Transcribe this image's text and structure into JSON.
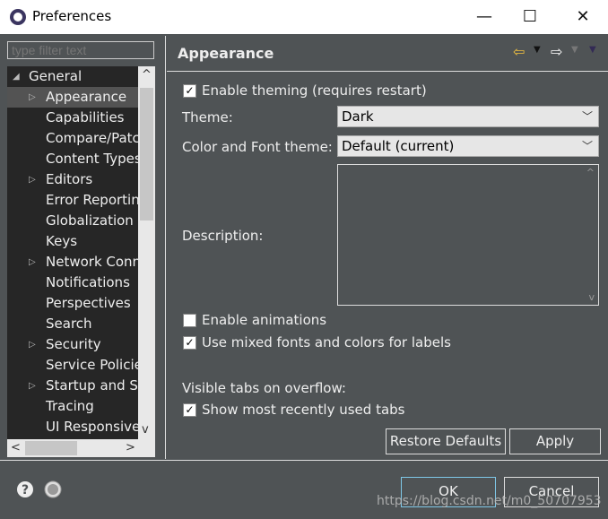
{
  "window": {
    "title": "Preferences",
    "minimize": "—",
    "maximize": "☐",
    "close": "✕"
  },
  "filter": {
    "placeholder": "type filter text"
  },
  "tree": {
    "items": [
      {
        "label": "General",
        "expanded": true,
        "level": 0
      },
      {
        "label": "Appearance",
        "selected": true,
        "level": 1,
        "expandable": true
      },
      {
        "label": "Capabilities",
        "level": 1
      },
      {
        "label": "Compare/Patch",
        "level": 1
      },
      {
        "label": "Content Types",
        "level": 1
      },
      {
        "label": "Editors",
        "level": 1,
        "expandable": true
      },
      {
        "label": "Error Reporting",
        "level": 1
      },
      {
        "label": "Globalization",
        "level": 1
      },
      {
        "label": "Keys",
        "level": 1
      },
      {
        "label": "Network Connections",
        "level": 1,
        "expandable": true
      },
      {
        "label": "Notifications",
        "level": 1
      },
      {
        "label": "Perspectives",
        "level": 1
      },
      {
        "label": "Search",
        "level": 1
      },
      {
        "label": "Security",
        "level": 1,
        "expandable": true
      },
      {
        "label": "Service Policies",
        "level": 1
      },
      {
        "label": "Startup and Shutdown",
        "level": 1,
        "expandable": true
      },
      {
        "label": "Tracing",
        "level": 1
      },
      {
        "label": "UI Responsiveness",
        "level": 1
      }
    ]
  },
  "page": {
    "title": "Appearance",
    "enable_theming": {
      "label": "Enable theming (requires restart)",
      "checked": true
    },
    "theme": {
      "label": "Theme:",
      "value": "Dark"
    },
    "color_font_theme": {
      "label": "Color and Font theme:",
      "value": "Default (current)"
    },
    "description": {
      "label": "Description:",
      "value": ""
    },
    "enable_animations": {
      "label": "Enable animations",
      "checked": false
    },
    "mixed_fonts": {
      "label": "Use mixed fonts and colors for labels",
      "checked": true
    },
    "visible_tabs_label": "Visible tabs on overflow:",
    "show_recent_tabs": {
      "label": "Show most recently used tabs",
      "checked": true
    },
    "restore_defaults": "Restore Defaults",
    "apply": "Apply"
  },
  "footer": {
    "ok": "OK",
    "cancel": "Cancel"
  },
  "watermark": "https://blog.csdn.net/m0_50707953",
  "colors": {
    "background": "#4f5355",
    "tree_background": "#262626",
    "selection": "#535353",
    "back_arrow": "#f0c040"
  }
}
